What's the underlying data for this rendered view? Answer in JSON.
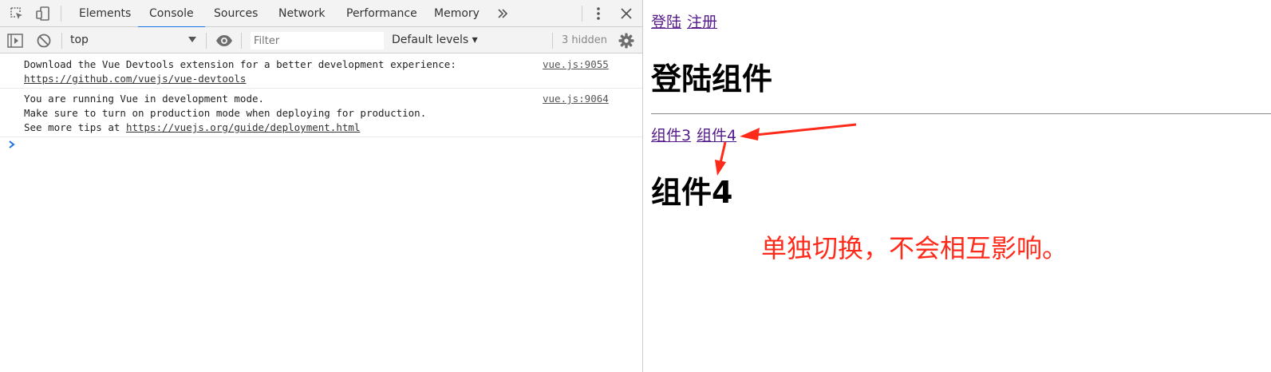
{
  "devtools": {
    "tabs": [
      "Elements",
      "Console",
      "Sources",
      "Network",
      "Performance",
      "Memory"
    ],
    "active_tab": "Console",
    "icons": {
      "inspect": "inspect-element-icon",
      "device": "device-toolbar-icon",
      "more_tabs": "chevron-double-right-icon",
      "menu": "vertical-ellipsis-icon",
      "close": "close-icon"
    },
    "toolbar": {
      "context": "top",
      "filter_placeholder": "Filter",
      "filter_value": "",
      "levels": "Default levels",
      "hidden": "3 hidden"
    },
    "messages": [
      {
        "lines": [
          "Download the Vue Devtools extension for a better development experience:"
        ],
        "link": "https://github.com/vuejs/vue-devtools",
        "link_prefix": "",
        "source": "vue.js:9055"
      },
      {
        "lines": [
          "You are running Vue in development mode.",
          "Make sure to turn on production mode when deploying for production."
        ],
        "link_prefix": "See more tips at ",
        "link": "https://vuejs.org/guide/deployment.html",
        "source": "vue.js:9064"
      }
    ]
  },
  "page": {
    "nav_links": [
      "登陆",
      "注册"
    ],
    "heading": "登陆组件",
    "sub_links": [
      "组件3",
      "组件4"
    ],
    "sub_heading": "组件4",
    "annotation": "单独切换，不会相互影响。",
    "annotation_color": "#ff2a1a"
  }
}
